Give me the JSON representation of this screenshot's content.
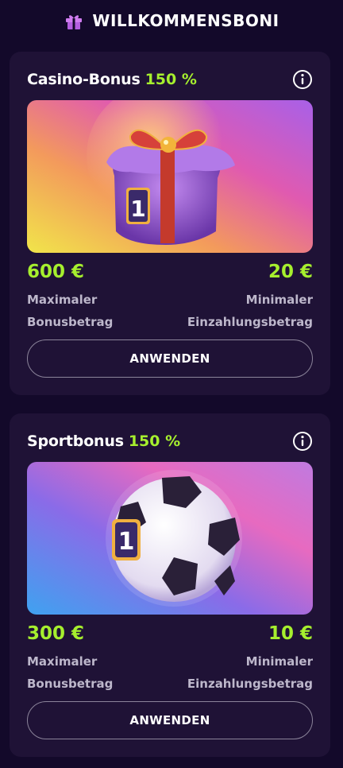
{
  "header": {
    "title": "WILLKOMMENSBONI",
    "icon": "gift-icon",
    "icon_color": "#d07cf0"
  },
  "colors": {
    "background": "#13092a",
    "card": "#1f1236",
    "accent": "#a6ef2e",
    "label": "#bdb7cb"
  },
  "bonuses": [
    {
      "title": "Casino-Bonus",
      "percent": "150 %",
      "image": "gift-box-illustration",
      "max_value": "600 €",
      "max_label_line1": "Maximaler",
      "max_label_line2": "Bonusbetrag",
      "min_value": "20 €",
      "min_label_line1": "Minimaler",
      "min_label_line2": "Einzahlungsbetrag",
      "button_label": "ANWENDEN",
      "badge": "1"
    },
    {
      "title": "Sportbonus",
      "percent": "150 %",
      "image": "soccer-ball-illustration",
      "max_value": "300 €",
      "max_label_line1": "Maximaler",
      "max_label_line2": "Bonusbetrag",
      "min_value": "10 €",
      "min_label_line1": "Minimaler",
      "min_label_line2": "Einzahlungsbetrag",
      "button_label": "ANWENDEN",
      "badge": "1"
    }
  ]
}
